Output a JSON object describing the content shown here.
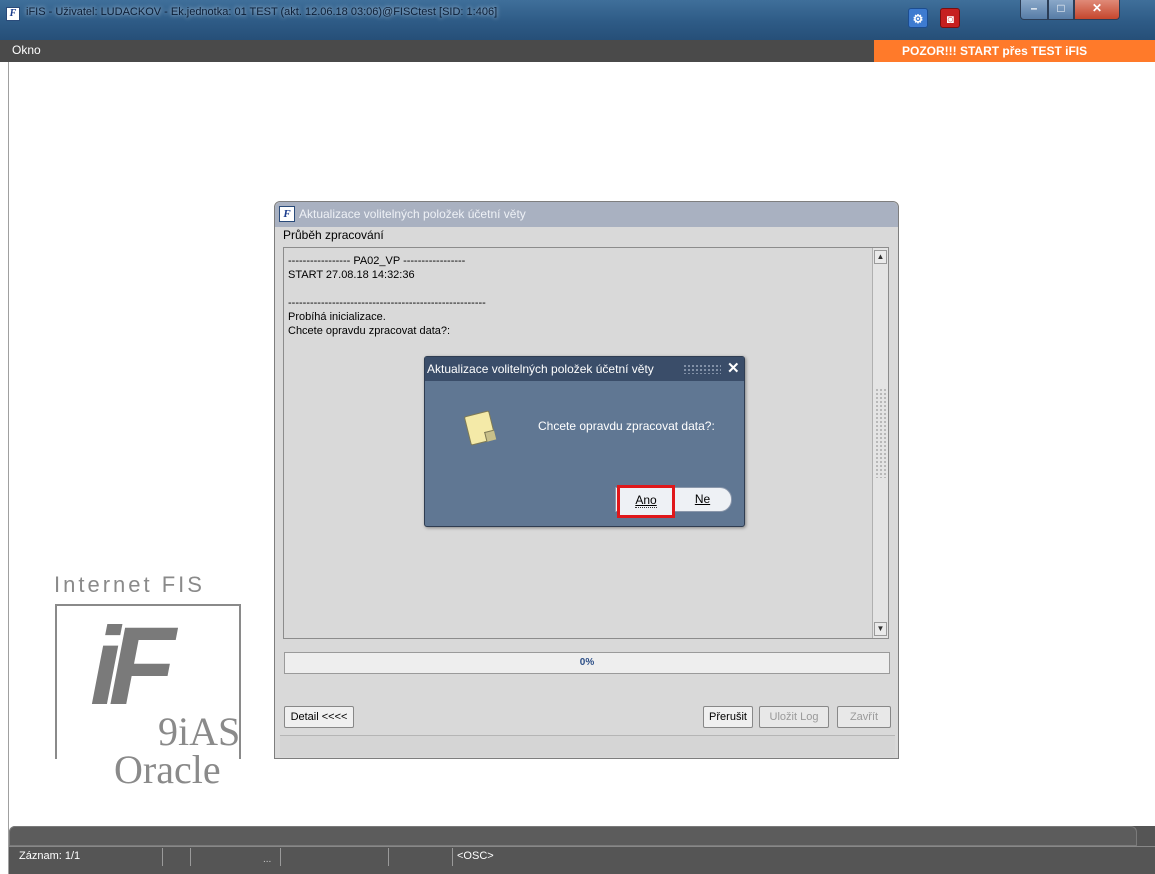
{
  "window": {
    "title": "iFIS - Uživatel: LUDACKOV - Ek.jednotka: 01 TEST (akt. 12.06.18 03:06)@FISCtest   [SID: 1:406]",
    "icon": "app-icon"
  },
  "menubar": {
    "okno": "Okno",
    "warning": "POZOR!!!  START přes TEST iFIS"
  },
  "logo": {
    "text": "Internet FIS",
    "mark": "iF",
    "tag": "9iAS",
    "vendor": "Oracle"
  },
  "dialog": {
    "title": "Aktualizace volitelných položek účetní věty",
    "section_label": "Průběh zpracování",
    "log_lines": "----------------- PA02_VP -----------------\nSTART 27.08.18 14:32:36\n\n------------------------------------------------------\nProbíhá inicializace.\nChcete opravdu zpracovat data?:",
    "progress": {
      "label": "0%",
      "value": 0
    },
    "buttons": {
      "detail": "Detail <<<<",
      "prerusit": "Přerušit",
      "ulozit_log": "Uložit Log",
      "zavrit": "Zavřít"
    }
  },
  "popup": {
    "title": "Aktualizace volitelných položek účetní věty",
    "message": "Chcete opravdu zpracovat data?:",
    "yes": "Ano",
    "no": "Ne"
  },
  "statusbar": {
    "record": "Záznam: 1/1",
    "dots": "...",
    "mode": "<OSC>"
  },
  "colors": {
    "warning_bg": "#ff7a2a",
    "popup_bg": "#607793",
    "highlight": "#e0171a"
  }
}
